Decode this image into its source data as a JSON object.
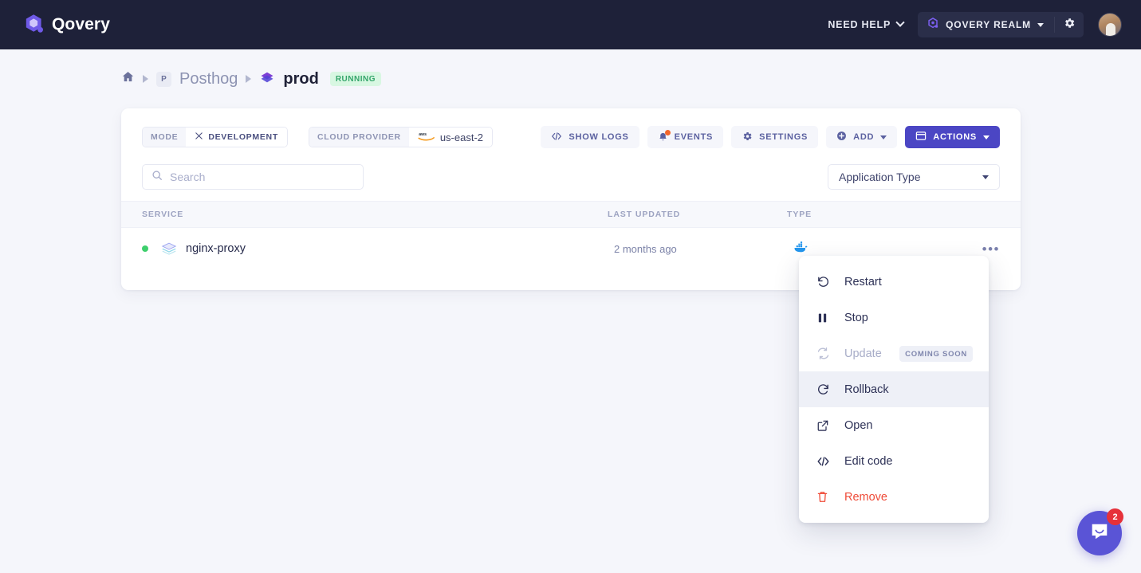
{
  "topbar": {
    "brand": "Qovery",
    "brand_icon": "qovery-logo-icon",
    "need_help": "NEED HELP",
    "realm": "QOVERY REALM",
    "realm_icon": "qovery-mark-icon",
    "settings_icon": "gear-icon",
    "avatar": "user-avatar",
    "bg_color": "#1e2139"
  },
  "breadcrumb": {
    "home_icon": "home-icon",
    "org_chip": "P",
    "org": "Posthog",
    "env": "prod",
    "env_icon": "environment-icon",
    "status": "RUNNING",
    "status_color": "#34a56a"
  },
  "toolbar": {
    "mode_label": "MODE",
    "mode_value": "DEVELOPMENT",
    "mode_icon": "tools-icon",
    "provider_label": "CLOUD PROVIDER",
    "provider_value": "us-east-2",
    "provider_icon": "aws-icon",
    "show_logs": "SHOW LOGS",
    "show_logs_icon": "code-icon",
    "events": "EVENTS",
    "events_icon": "bell-icon",
    "settings": "SETTINGS",
    "settings_icon": "gear-icon",
    "add": "ADD",
    "add_icon": "plus-circle-icon",
    "actions": "ACTIONS",
    "actions_icon": "window-icon",
    "primary_color": "#4b46c4"
  },
  "filters": {
    "search_placeholder": "Search",
    "search_value": "",
    "search_icon": "search-icon",
    "type_select": "Application Type"
  },
  "table": {
    "columns": [
      "SERVICE",
      "LAST UPDATED",
      "TYPE"
    ],
    "rows": [
      {
        "status": "running",
        "status_color": "#3ecf6d",
        "icon": "layers-icon",
        "name": "nginx-proxy",
        "last_updated": "2 months ago",
        "type_icon": "docker-icon",
        "more_icon": "ellipsis-icon"
      }
    ]
  },
  "context_menu": {
    "items": [
      {
        "label": "Restart",
        "icon": "restart-icon",
        "state": "normal"
      },
      {
        "label": "Stop",
        "icon": "pause-icon",
        "state": "normal"
      },
      {
        "label": "Update",
        "icon": "refresh-icon",
        "state": "disabled",
        "badge": "COMING SOON"
      },
      {
        "label": "Rollback",
        "icon": "history-icon",
        "state": "active"
      },
      {
        "label": "Open",
        "icon": "external-link-icon",
        "state": "normal"
      },
      {
        "label": "Edit code",
        "icon": "code-icon",
        "state": "normal"
      },
      {
        "label": "Remove",
        "icon": "trash-icon",
        "state": "danger"
      }
    ]
  },
  "intercom": {
    "icon": "chat-bubble-icon",
    "unread": "2",
    "color": "#5a54d6"
  }
}
